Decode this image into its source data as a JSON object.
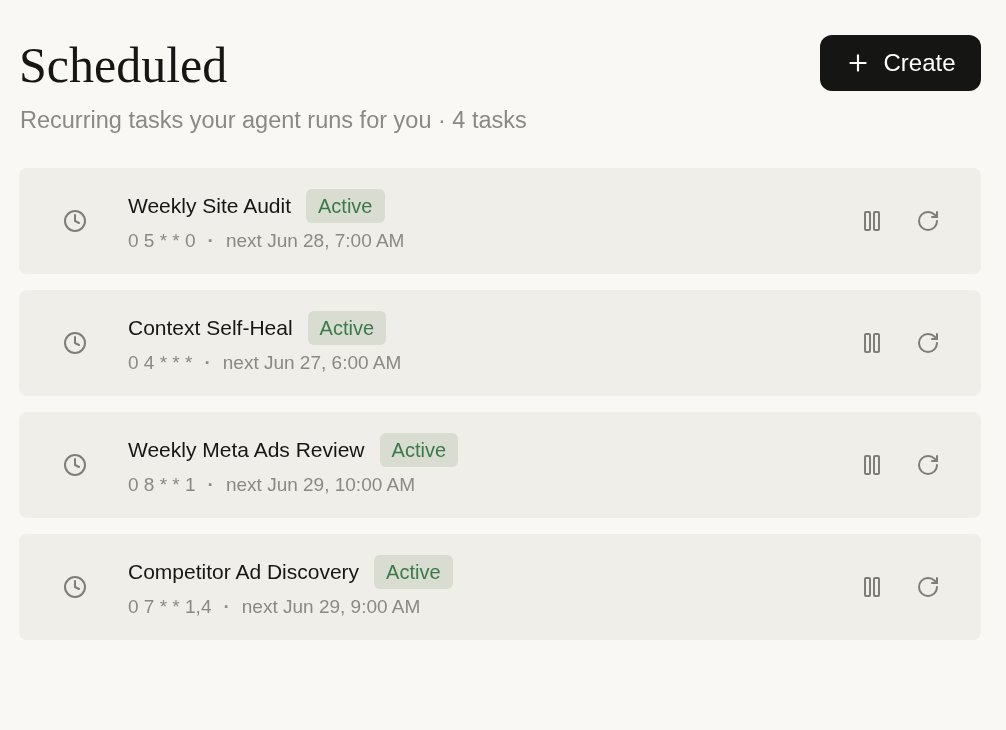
{
  "header": {
    "title": "Scheduled",
    "subtitle": "Recurring tasks your agent runs for you · 4 tasks",
    "create_button": {
      "label": "Create"
    }
  },
  "tasks": [
    {
      "name": "Weekly Site Audit",
      "status": {
        "label": "Active",
        "kind": "active"
      },
      "cron": "0 5 * * 0",
      "separator": "·",
      "next": "next Jun 28, 7:00 AM"
    },
    {
      "name": "Context Self-Heal",
      "status": {
        "label": "Active",
        "kind": "active"
      },
      "cron": "0 4 * * *",
      "separator": "·",
      "next": "next Jun 27, 6:00 AM"
    },
    {
      "name": "Weekly Meta Ads Review",
      "status": {
        "label": "Active",
        "kind": "active"
      },
      "cron": "0 8 * * 1",
      "separator": "·",
      "next": "next Jun 29, 10:00 AM"
    },
    {
      "name": "Competitor Ad Discovery",
      "status": {
        "label": "Active",
        "kind": "active"
      },
      "cron": "0 7 * * 1,4",
      "separator": "·",
      "next": "next Jun 29, 9:00 AM"
    }
  ]
}
